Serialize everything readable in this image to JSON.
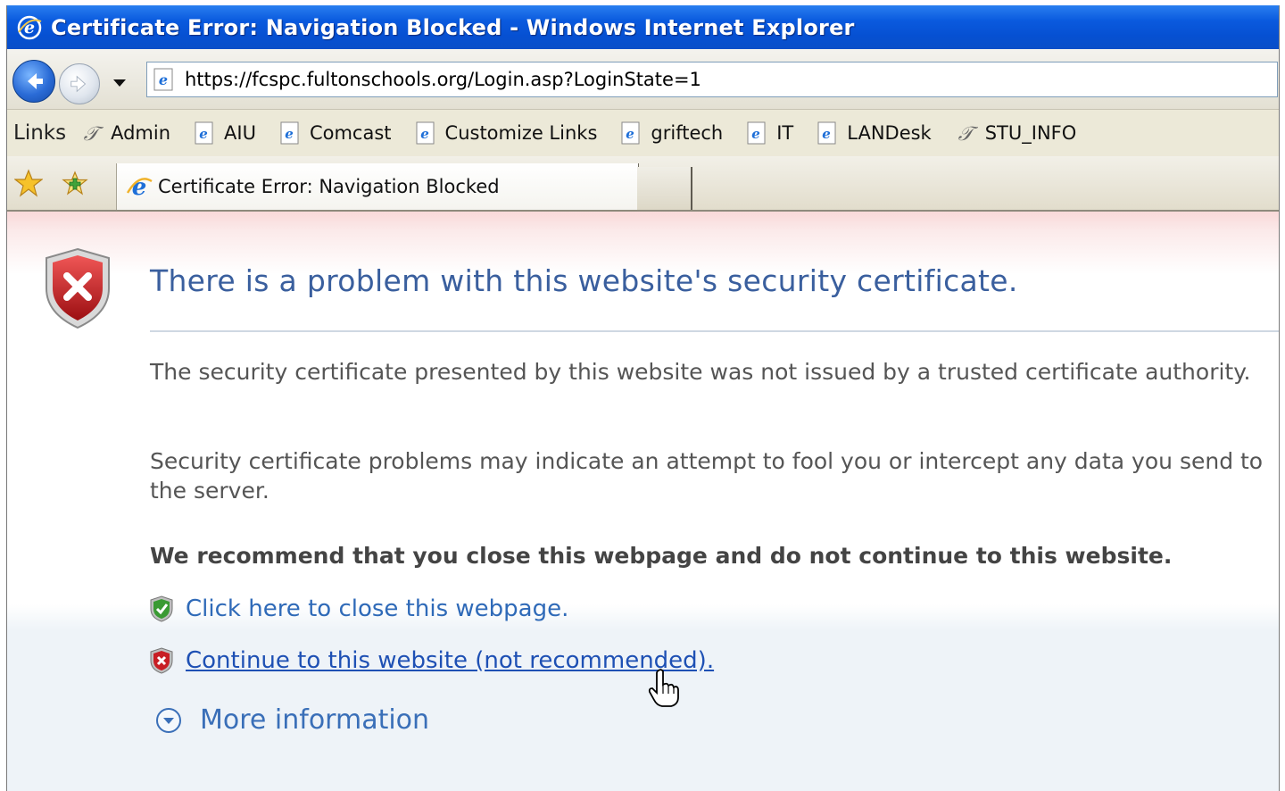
{
  "window": {
    "title": "Certificate Error: Navigation Blocked - Windows Internet Explorer"
  },
  "address_bar": {
    "url": "https://fcspc.fultonschools.org/Login.asp?LoginState=1"
  },
  "links_bar": {
    "label": "Links",
    "items": [
      {
        "label": "Admin",
        "icon": "script-icon"
      },
      {
        "label": "AIU",
        "icon": "ie-page-icon"
      },
      {
        "label": "Comcast",
        "icon": "ie-page-icon"
      },
      {
        "label": "Customize Links",
        "icon": "ie-page-icon"
      },
      {
        "label": "griftech",
        "icon": "ie-page-icon"
      },
      {
        "label": "IT",
        "icon": "ie-page-icon"
      },
      {
        "label": "LANDesk",
        "icon": "ie-page-icon"
      },
      {
        "label": "STU_INFO",
        "icon": "script-icon"
      }
    ]
  },
  "tabs": {
    "active_title": "Certificate Error: Navigation Blocked"
  },
  "page": {
    "heading": "There is a problem with this website's security certificate.",
    "para1": "The security certificate presented by this website was not issued by a trusted certificate authority.",
    "para2": "Security certificate problems may indicate an attempt to fool you or intercept any data you send to the server.",
    "recommend": "We recommend that you close this webpage and do not continue to this website.",
    "close_link": "Click here to close this webpage.",
    "continue_link": "Continue to this website (not recommended).",
    "more_info": "More information"
  },
  "colors": {
    "titlebar": "#0a5ade",
    "heading": "#3a5f9e",
    "link": "#2f6ab8"
  }
}
